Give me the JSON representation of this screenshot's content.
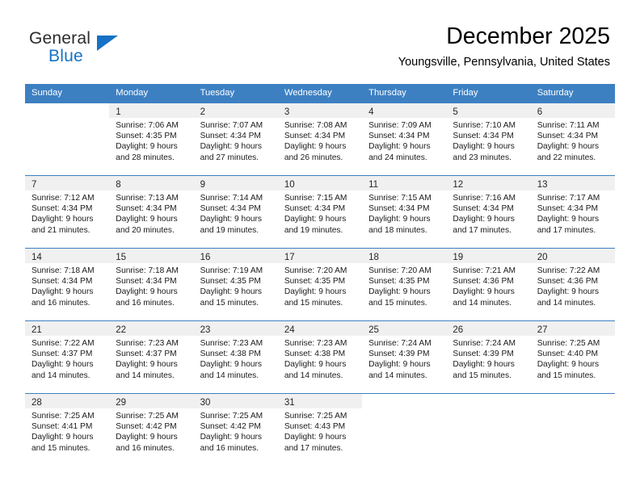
{
  "brand": {
    "name_part1": "General",
    "name_part2": "Blue",
    "accent_color": "#1572c4"
  },
  "header": {
    "month_title": "December 2025",
    "location": "Youngsville, Pennsylvania, United States"
  },
  "calendar": {
    "header_color": "#3d80c2",
    "weekday_headers": [
      "Sunday",
      "Monday",
      "Tuesday",
      "Wednesday",
      "Thursday",
      "Friday",
      "Saturday"
    ],
    "weeks": [
      [
        {
          "day": "",
          "details": ""
        },
        {
          "day": "1",
          "details": "Sunrise: 7:06 AM\nSunset: 4:35 PM\nDaylight: 9 hours\nand 28 minutes."
        },
        {
          "day": "2",
          "details": "Sunrise: 7:07 AM\nSunset: 4:34 PM\nDaylight: 9 hours\nand 27 minutes."
        },
        {
          "day": "3",
          "details": "Sunrise: 7:08 AM\nSunset: 4:34 PM\nDaylight: 9 hours\nand 26 minutes."
        },
        {
          "day": "4",
          "details": "Sunrise: 7:09 AM\nSunset: 4:34 PM\nDaylight: 9 hours\nand 24 minutes."
        },
        {
          "day": "5",
          "details": "Sunrise: 7:10 AM\nSunset: 4:34 PM\nDaylight: 9 hours\nand 23 minutes."
        },
        {
          "day": "6",
          "details": "Sunrise: 7:11 AM\nSunset: 4:34 PM\nDaylight: 9 hours\nand 22 minutes."
        }
      ],
      [
        {
          "day": "7",
          "details": "Sunrise: 7:12 AM\nSunset: 4:34 PM\nDaylight: 9 hours\nand 21 minutes."
        },
        {
          "day": "8",
          "details": "Sunrise: 7:13 AM\nSunset: 4:34 PM\nDaylight: 9 hours\nand 20 minutes."
        },
        {
          "day": "9",
          "details": "Sunrise: 7:14 AM\nSunset: 4:34 PM\nDaylight: 9 hours\nand 19 minutes."
        },
        {
          "day": "10",
          "details": "Sunrise: 7:15 AM\nSunset: 4:34 PM\nDaylight: 9 hours\nand 19 minutes."
        },
        {
          "day": "11",
          "details": "Sunrise: 7:15 AM\nSunset: 4:34 PM\nDaylight: 9 hours\nand 18 minutes."
        },
        {
          "day": "12",
          "details": "Sunrise: 7:16 AM\nSunset: 4:34 PM\nDaylight: 9 hours\nand 17 minutes."
        },
        {
          "day": "13",
          "details": "Sunrise: 7:17 AM\nSunset: 4:34 PM\nDaylight: 9 hours\nand 17 minutes."
        }
      ],
      [
        {
          "day": "14",
          "details": "Sunrise: 7:18 AM\nSunset: 4:34 PM\nDaylight: 9 hours\nand 16 minutes."
        },
        {
          "day": "15",
          "details": "Sunrise: 7:18 AM\nSunset: 4:34 PM\nDaylight: 9 hours\nand 16 minutes."
        },
        {
          "day": "16",
          "details": "Sunrise: 7:19 AM\nSunset: 4:35 PM\nDaylight: 9 hours\nand 15 minutes."
        },
        {
          "day": "17",
          "details": "Sunrise: 7:20 AM\nSunset: 4:35 PM\nDaylight: 9 hours\nand 15 minutes."
        },
        {
          "day": "18",
          "details": "Sunrise: 7:20 AM\nSunset: 4:35 PM\nDaylight: 9 hours\nand 15 minutes."
        },
        {
          "day": "19",
          "details": "Sunrise: 7:21 AM\nSunset: 4:36 PM\nDaylight: 9 hours\nand 14 minutes."
        },
        {
          "day": "20",
          "details": "Sunrise: 7:22 AM\nSunset: 4:36 PM\nDaylight: 9 hours\nand 14 minutes."
        }
      ],
      [
        {
          "day": "21",
          "details": "Sunrise: 7:22 AM\nSunset: 4:37 PM\nDaylight: 9 hours\nand 14 minutes."
        },
        {
          "day": "22",
          "details": "Sunrise: 7:23 AM\nSunset: 4:37 PM\nDaylight: 9 hours\nand 14 minutes."
        },
        {
          "day": "23",
          "details": "Sunrise: 7:23 AM\nSunset: 4:38 PM\nDaylight: 9 hours\nand 14 minutes."
        },
        {
          "day": "24",
          "details": "Sunrise: 7:23 AM\nSunset: 4:38 PM\nDaylight: 9 hours\nand 14 minutes."
        },
        {
          "day": "25",
          "details": "Sunrise: 7:24 AM\nSunset: 4:39 PM\nDaylight: 9 hours\nand 14 minutes."
        },
        {
          "day": "26",
          "details": "Sunrise: 7:24 AM\nSunset: 4:39 PM\nDaylight: 9 hours\nand 15 minutes."
        },
        {
          "day": "27",
          "details": "Sunrise: 7:25 AM\nSunset: 4:40 PM\nDaylight: 9 hours\nand 15 minutes."
        }
      ],
      [
        {
          "day": "28",
          "details": "Sunrise: 7:25 AM\nSunset: 4:41 PM\nDaylight: 9 hours\nand 15 minutes."
        },
        {
          "day": "29",
          "details": "Sunrise: 7:25 AM\nSunset: 4:42 PM\nDaylight: 9 hours\nand 16 minutes."
        },
        {
          "day": "30",
          "details": "Sunrise: 7:25 AM\nSunset: 4:42 PM\nDaylight: 9 hours\nand 16 minutes."
        },
        {
          "day": "31",
          "details": "Sunrise: 7:25 AM\nSunset: 4:43 PM\nDaylight: 9 hours\nand 17 minutes."
        },
        {
          "day": "",
          "details": ""
        },
        {
          "day": "",
          "details": ""
        },
        {
          "day": "",
          "details": ""
        }
      ]
    ]
  }
}
